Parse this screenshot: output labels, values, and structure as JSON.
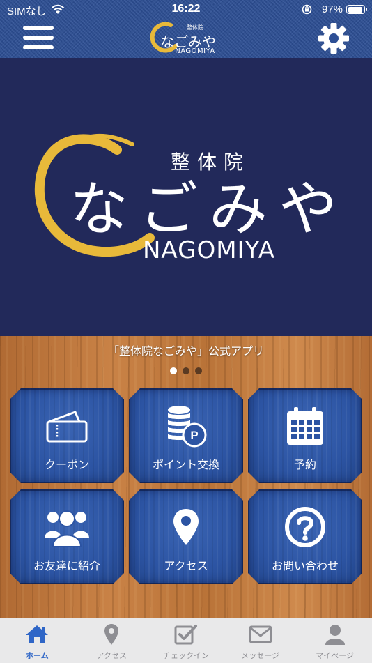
{
  "status_bar": {
    "carrier": "SIMなし",
    "time": "16:22",
    "battery_percent": "97%",
    "battery_level": 0.97
  },
  "header": {
    "logo_small": "整体院",
    "logo_text": "なごみや",
    "logo_roman": "NAGOMIYA",
    "menu_icon": "hamburger-icon",
    "settings_icon": "gear-icon"
  },
  "hero": {
    "logo_small": "整体院",
    "logo_text": "なごみや",
    "logo_roman": "NAGOMIYA",
    "ring_color": "#e8b93a",
    "background_color": "#22295a"
  },
  "carousel": {
    "caption": "「整体院なごみや」公式アプリ",
    "page_count": 3,
    "active_index": 0
  },
  "tiles": [
    {
      "label": "クーポン",
      "icon": "coupon-ticket-icon"
    },
    {
      "label": "ポイント交換",
      "icon": "points-coins-icon"
    },
    {
      "label": "予約",
      "icon": "calendar-icon"
    },
    {
      "label": "お友達に紹介",
      "icon": "group-people-icon"
    },
    {
      "label": "アクセス",
      "icon": "map-pin-icon"
    },
    {
      "label": "お問い合わせ",
      "icon": "question-icon"
    }
  ],
  "tabbar": {
    "items": [
      {
        "label": "ホーム",
        "icon": "home-icon",
        "active": true
      },
      {
        "label": "アクセス",
        "icon": "map-pin-icon",
        "active": false
      },
      {
        "label": "チェックイン",
        "icon": "checkin-icon",
        "active": false
      },
      {
        "label": "メッセージ",
        "icon": "envelope-icon",
        "active": false
      },
      {
        "label": "マイページ",
        "icon": "person-icon",
        "active": false
      }
    ],
    "active_color": "#2f66c7",
    "inactive_color": "#8e8e93"
  }
}
